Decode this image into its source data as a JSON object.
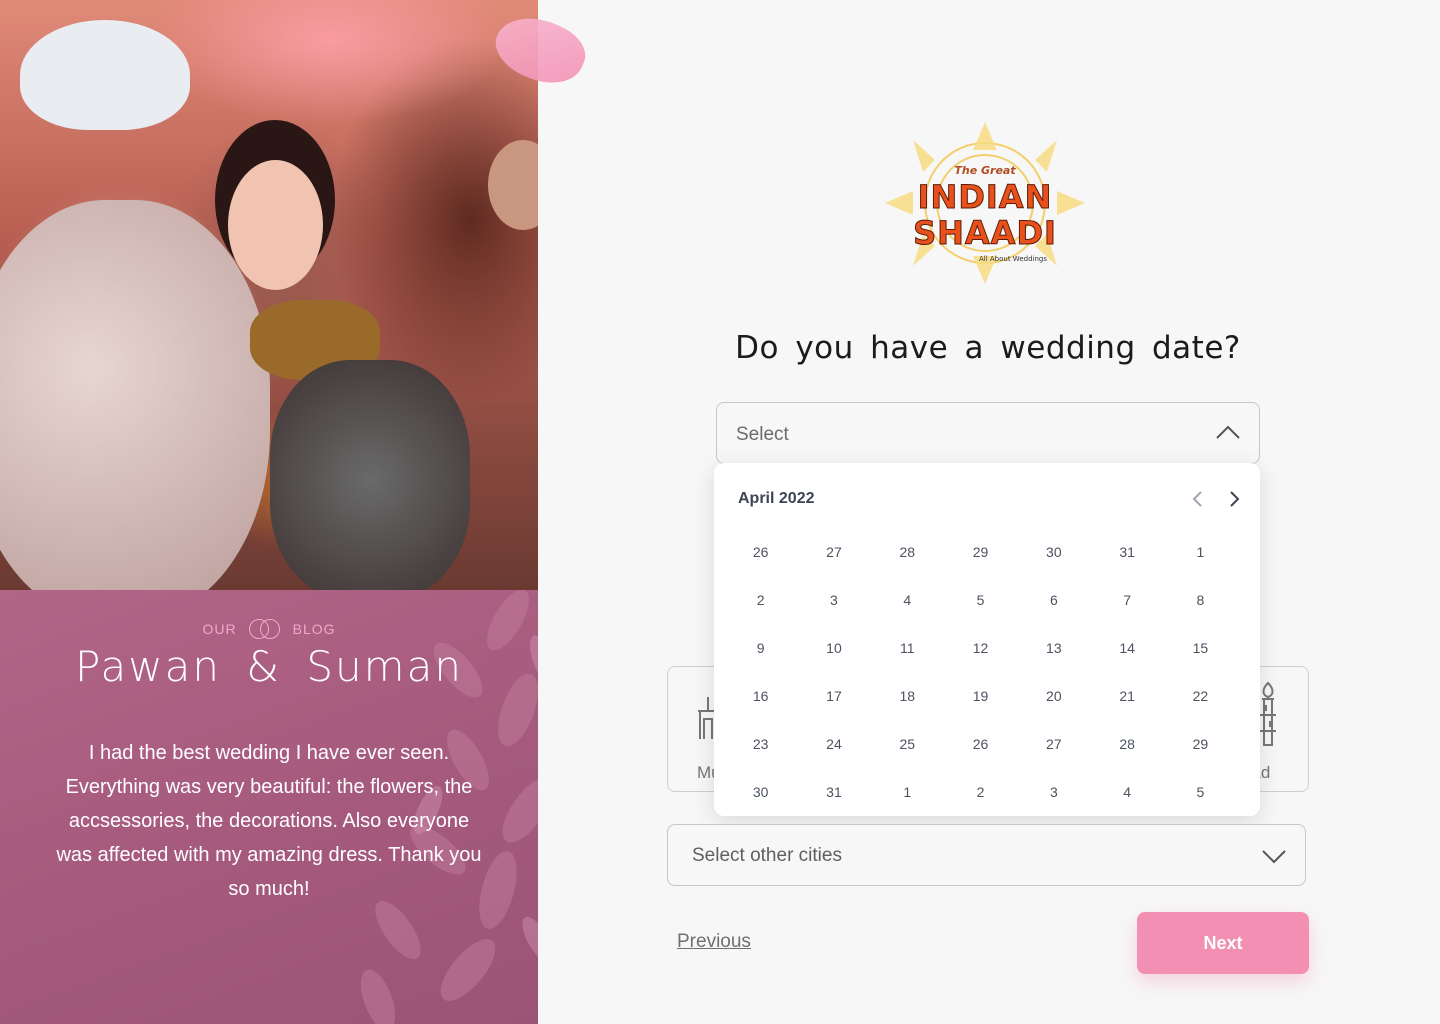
{
  "blog": {
    "label_left": "OUR",
    "label_right": "BLOG",
    "couple_name": "Pawan & Suman",
    "testimonial": "I had the best wedding I have ever seen. Everything was very beautiful: the flowers, the accsessories, the decorations. Also everyone was affected with my amazing dress. Thank you so much!"
  },
  "logo": {
    "line1": "The Great",
    "line2": "INDIAN",
    "line3": "SHAADI",
    "tagline": "All About Weddings"
  },
  "question": "Do you have a wedding date?",
  "date_select": {
    "placeholder": "Select",
    "icon": "chevron-up-icon"
  },
  "calendar": {
    "month_label": "April 2022",
    "prev_icon": "chevron-left-icon",
    "next_icon": "chevron-right-icon",
    "days": [
      "26",
      "27",
      "28",
      "29",
      "30",
      "31",
      "1",
      "2",
      "3",
      "4",
      "5",
      "6",
      "7",
      "8",
      "9",
      "10",
      "11",
      "12",
      "13",
      "14",
      "15",
      "16",
      "17",
      "18",
      "19",
      "20",
      "21",
      "22",
      "23",
      "24",
      "25",
      "26",
      "27",
      "28",
      "29",
      "30",
      "31",
      "1",
      "2",
      "3",
      "4",
      "5"
    ]
  },
  "city_cards": [
    {
      "label": "Mu",
      "icon": "monument-icon"
    },
    {
      "label": "bad",
      "icon": "minaret-icon"
    }
  ],
  "cities_select": {
    "placeholder": "Select other cities",
    "icon": "chevron-down-icon"
  },
  "nav": {
    "previous_label": "Previous",
    "next_label": "Next"
  },
  "colors": {
    "accent": "#f28fb3",
    "blog_bg": "#a55a7d",
    "text_dark": "#1b1b1b"
  }
}
